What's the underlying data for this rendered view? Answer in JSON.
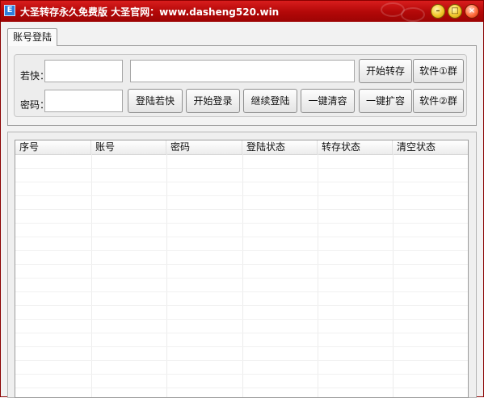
{
  "window": {
    "title": "大圣转存永久免费版  大圣官网：www.dasheng520.win",
    "icon": "app-icon",
    "buttons": [
      "minimize-icon",
      "maximize-icon",
      "close-icon"
    ],
    "colors": {
      "titlebar": "#b20808",
      "window_bg": "#f2f2f2"
    }
  },
  "tabs": [
    {
      "label": "账号登陆"
    }
  ],
  "form": {
    "cookie_label": "若快：",
    "password_label": "密码：",
    "cookie_value": "",
    "password_value": "",
    "wide_value": ""
  },
  "buttons": {
    "login_ruokuai": "登陆若快",
    "start_login": "开始登录",
    "continue_login": "继续登陆",
    "one_click_clear": "一键清容",
    "start_transfer": "开始转存",
    "one_click_expand": "一键扩容",
    "software_group_1": "软件①群",
    "software_group_2": "软件②群"
  },
  "table": {
    "columns": [
      "序号",
      "账号",
      "密码",
      "登陆状态",
      "转存状态",
      "清空状态"
    ],
    "rows": []
  }
}
